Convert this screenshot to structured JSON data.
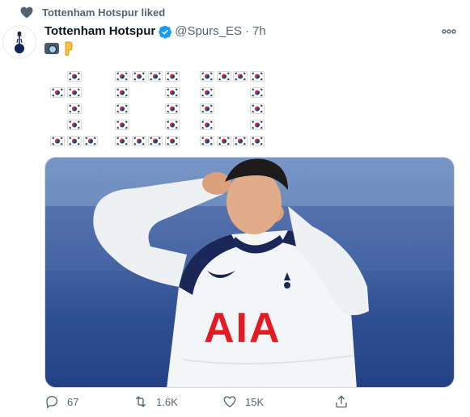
{
  "social_context": {
    "text": "Tottenham Hotspur liked"
  },
  "tweet": {
    "author_name": "Tottenham Hotspur",
    "handle": "@Spurs_ES",
    "separator": "·",
    "time": "7h",
    "text_emoji": [
      "camera-with-flash",
      "backhand-index-pointing-down"
    ],
    "flag_art": {
      "emoji": "south-korea-flag",
      "depicts": "100"
    },
    "media": {
      "alt_subject": "Player in white Tottenham kit with AIA sponsor making a heart gesture"
    },
    "actions": {
      "reply_count": "67",
      "retweet_count": "1.6K",
      "like_count": "15K"
    }
  },
  "colors": {
    "secondary_text": "#536471",
    "verified_blue": "#1d9bf0",
    "kit_sponsor_red": "#e31b23"
  }
}
